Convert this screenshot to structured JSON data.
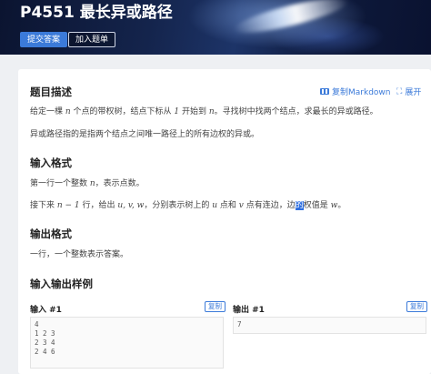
{
  "header": {
    "title": "P4551 最长异或路径",
    "submit_label": "提交答案",
    "add_label": "加入题单"
  },
  "tools": {
    "copy_markdown": "复制Markdown",
    "expand": "展开"
  },
  "sections": {
    "description": {
      "heading": "题目描述",
      "line1": {
        "a": "给定一棵 ",
        "b": "n",
        "c": " 个点的带权树，结点下标从 ",
        "d": "1",
        "e": " 开始到 ",
        "f": "n",
        "g": "。寻找树中找两个结点，求最长的异或路径。"
      },
      "line2": "异或路径指的是指两个结点之间唯一路径上的所有边权的异或。"
    },
    "input_format": {
      "heading": "输入格式",
      "line1": {
        "a": "第一行一个整数 ",
        "b": "n",
        "c": "，表示点数。"
      },
      "line2": {
        "a": "接下来 ",
        "b": "n − 1",
        "c": " 行，给出 ",
        "d": "u, v, w",
        "e": "，分别表示树上的 ",
        "f": "u",
        "g": " 点和 ",
        "h": "v",
        "i": " 点有连边，边",
        "j": "的",
        "k": "权值是 ",
        "l": "w",
        "m": "。"
      }
    },
    "output_format": {
      "heading": "输出格式",
      "line1": "一行，一个整数表示答案。"
    },
    "samples": {
      "heading": "输入输出样例",
      "input_label": "输入 #1",
      "output_label": "输出 #1",
      "copy_label": "复制",
      "input_text": "4\n1 2 3\n2 3 4\n2 4 6",
      "output_text": "7"
    }
  },
  "colors": {
    "accent": "#3b7ad9",
    "banner": "#14244c"
  },
  "icons": [
    "markdown-icon",
    "expand-icon"
  ]
}
